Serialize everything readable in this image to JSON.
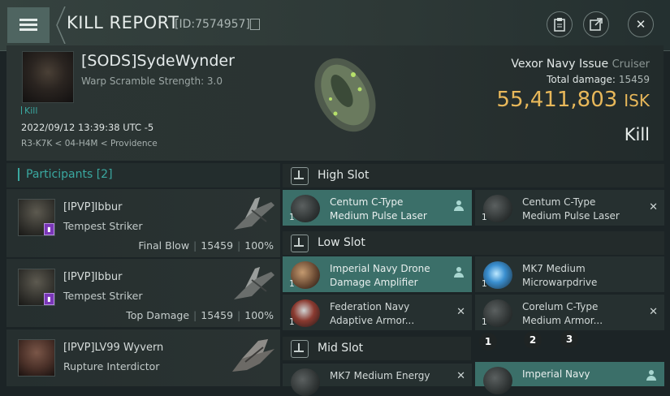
{
  "header": {
    "title": "KILL REPORT",
    "id_text": "[ID:7574957]"
  },
  "victim": {
    "name": "[SODS]SydeWynder",
    "warp_scramble": "Warp Scramble Strength: 3.0",
    "kill_link": "Kill",
    "datetime": "2022/09/12 13:39:38 UTC -5",
    "location": "R3-K7K < 04-H4M < Providence",
    "ship_name": "Vexor Navy Issue",
    "ship_class": "Cruiser",
    "total_damage_label": "Total damage:",
    "total_damage": "15459",
    "isk_value": "55,411,803",
    "isk_unit": "ISK",
    "result": "Kill"
  },
  "participants": {
    "label": "Participants",
    "count": "[2]",
    "rows": [
      {
        "name": "[IPVP]Ibbur",
        "ship": "Tempest Striker",
        "role": "Final Blow",
        "damage": "15459",
        "percent": "100%"
      },
      {
        "name": "[IPVP]Ibbur",
        "ship": "Tempest Striker",
        "role": "Top Damage",
        "damage": "15459",
        "percent": "100%"
      },
      {
        "name": "[IPVP]LV99 Wyvern",
        "ship": "Rupture Interdictor"
      }
    ]
  },
  "slots": {
    "high": {
      "label": "High Slot",
      "items": [
        {
          "qty": "1",
          "name_l1": "Centum C-Type",
          "name_l2": "Medium Pulse Laser"
        },
        {
          "qty": "1",
          "name_l1": "Centum C-Type",
          "name_l2": "Medium Pulse Laser"
        }
      ]
    },
    "low": {
      "label": "Low Slot",
      "items": [
        {
          "qty": "1",
          "name_l1": "Imperial Navy Drone",
          "name_l2": "Damage Amplifier"
        },
        {
          "qty": "1",
          "name_l1": "MK7 Medium",
          "name_l2": "Microwarpdrive"
        },
        {
          "qty": "1",
          "name_l1": "Federation Navy",
          "name_l2": "Adaptive Armor..."
        },
        {
          "qty": "1",
          "name_l1": "Corelum C-Type",
          "name_l2": "Medium Armor..."
        }
      ]
    },
    "mid": {
      "label": "Mid Slot",
      "items": [
        {
          "name_l1": "MK7 Medium Energy"
        },
        {
          "name_l1": "Imperial Navy"
        }
      ]
    }
  },
  "step_markers": [
    "1",
    "2",
    "3"
  ],
  "icons": {
    "close": "✕",
    "copy": "copy-icon",
    "remove": "✕"
  }
}
